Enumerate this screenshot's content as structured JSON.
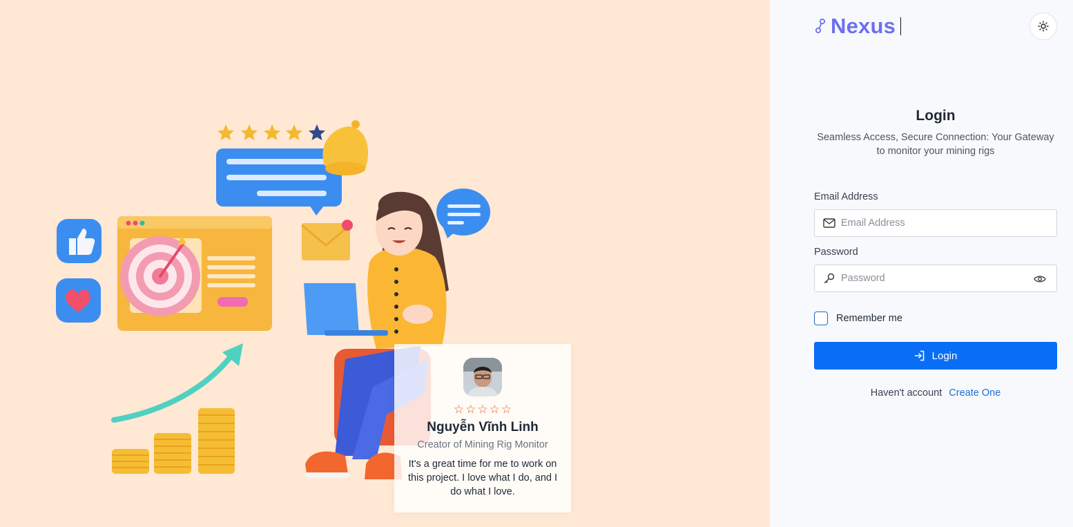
{
  "brand": {
    "name": "Nexus"
  },
  "testimonial": {
    "rating_max": 5,
    "stars": [
      "☆",
      "☆",
      "☆",
      "☆",
      "☆"
    ],
    "name": "Nguyễn Vĩnh Linh",
    "role": "Creator of Mining Rig Monitor",
    "quote": "It's a great time for me to work on this project. I love what I do, and I do what I love."
  },
  "login": {
    "title": "Login",
    "subtitle": "Seamless Access, Secure Connection: Your Gateway to monitor your mining rigs",
    "email_label": "Email Address",
    "email_placeholder": "Email Address",
    "email_value": "",
    "password_label": "Password",
    "password_placeholder": "Password",
    "password_value": "",
    "remember_label": "Remember me",
    "remember_checked": false,
    "submit_label": "Login",
    "signup_prompt": "Haven't account",
    "signup_link": "Create One"
  },
  "colors": {
    "hero_background": "#ffe8d4",
    "brand": "#6d6ff0",
    "primary_button": "#0a6df5",
    "link": "#1b6fd8",
    "star": "#ea580c"
  },
  "icons": {
    "brand": "link-chain-icon",
    "theme": "sun-icon",
    "email": "mail-icon",
    "password": "key-icon",
    "toggle": "eye-icon",
    "submit": "login-arrow-icon"
  }
}
